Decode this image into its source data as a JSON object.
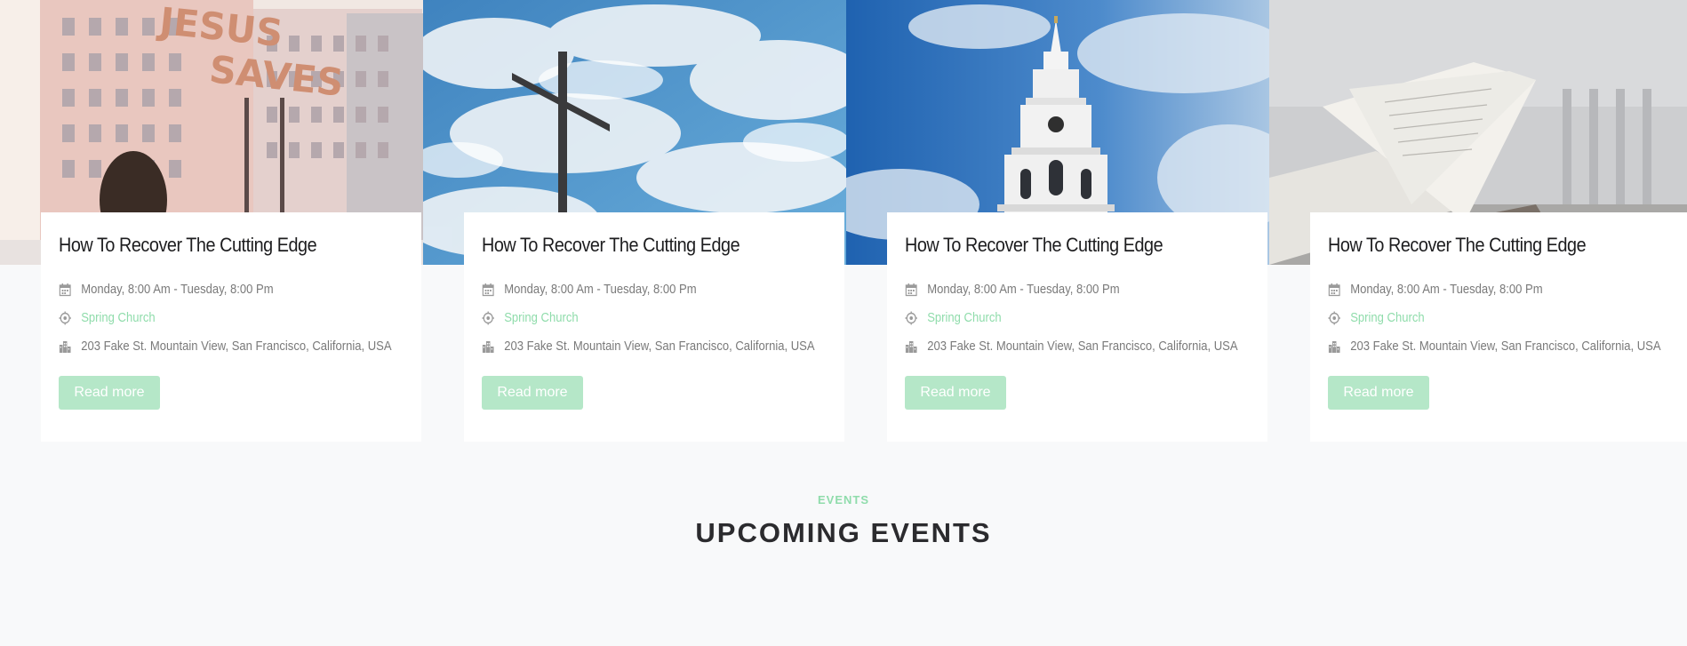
{
  "events": [
    {
      "title": "How To Recover The Cutting Edge",
      "date": "Monday, 8:00 Am - Tuesday, 8:00 Pm",
      "venue": "Spring Church",
      "address": "203 Fake St. Mountain View, San Francisco, California, USA",
      "button": "Read more",
      "image": "building-with-jesus-saves-sign"
    },
    {
      "title": "How To Recover The Cutting Edge",
      "date": "Monday, 8:00 Am - Tuesday, 8:00 Pm",
      "venue": "Spring Church",
      "address": "203 Fake St. Mountain View, San Francisco, California, USA",
      "button": "Read more",
      "image": "cross-against-cloudy-sky"
    },
    {
      "title": "How To Recover The Cutting Edge",
      "date": "Monday, 8:00 Am - Tuesday, 8:00 Pm",
      "venue": "Spring Church",
      "address": "203 Fake St. Mountain View, San Francisco, California, USA",
      "button": "Read more",
      "image": "church-steeple"
    },
    {
      "title": "How To Recover The Cutting Edge",
      "date": "Monday, 8:00 Am - Tuesday, 8:00 Pm",
      "venue": "Spring Church",
      "address": "203 Fake St. Mountain View, San Francisco, California, USA",
      "button": "Read more",
      "image": "open-book-pages"
    }
  ],
  "section": {
    "eyebrow": "EVENTS",
    "title": "UPCOMING EVENTS"
  },
  "colors": {
    "accent": "#8fdcab",
    "button": "#b5e7c8",
    "background": "#f8f9fa",
    "title": "#1d1d1f",
    "meta": "#7a7a7a"
  },
  "icons": {
    "date": "calendar-icon",
    "venue": "location-icon",
    "address": "building-icon"
  }
}
